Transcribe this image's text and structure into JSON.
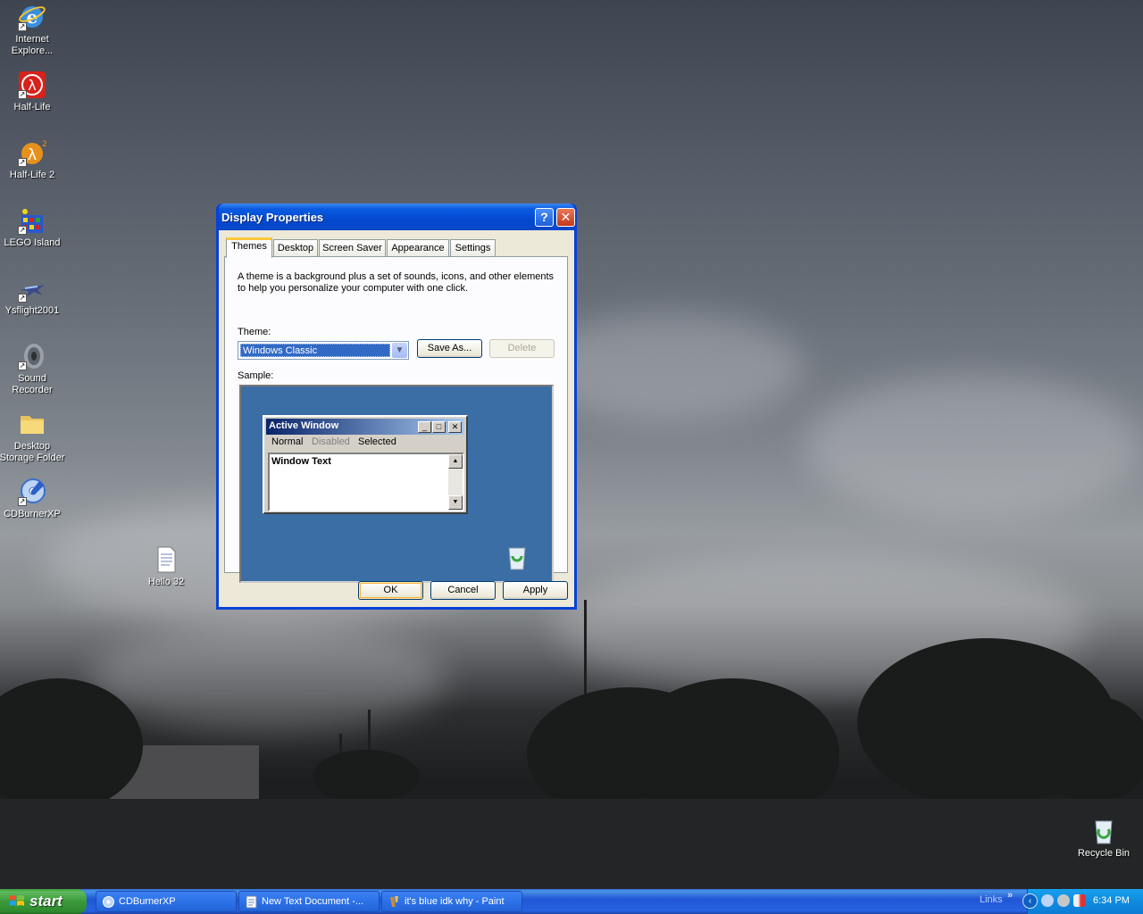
{
  "desktop": {
    "icons": [
      {
        "label": "Internet Explore...",
        "icon": "internet-explorer-icon"
      },
      {
        "label": "Half-Life",
        "icon": "half-life-icon"
      },
      {
        "label": "Half-Life 2",
        "icon": "half-life-2-icon"
      },
      {
        "label": "LEGO Island",
        "icon": "lego-island-icon"
      },
      {
        "label": "Ysflight2001",
        "icon": "ysflight-icon"
      },
      {
        "label": "Sound Recorder",
        "icon": "sound-recorder-icon"
      },
      {
        "label": "Desktop Storage Folder",
        "icon": "folder-icon"
      },
      {
        "label": "CDBurnerXP",
        "icon": "cdburnerxp-icon"
      },
      {
        "label": "Hello 32",
        "icon": "text-document-icon"
      },
      {
        "label": "Recycle Bin",
        "icon": "recycle-bin-icon"
      }
    ]
  },
  "dialog": {
    "title": "Display Properties",
    "help_glyph": "?",
    "close_glyph": "✕",
    "tabs": [
      "Themes",
      "Desktop",
      "Screen Saver",
      "Appearance",
      "Settings"
    ],
    "active_tab": "Themes",
    "description": "A theme is a background plus a set of sounds, icons, and other elements to help you personalize your computer with one click.",
    "theme_label": "Theme:",
    "theme_value": "Windows Classic",
    "save_as_label": "Save As...",
    "delete_label": "Delete",
    "sample_label": "Sample:",
    "sample": {
      "window_title": "Active Window",
      "menu": [
        "Normal",
        "Disabled",
        "Selected"
      ],
      "window_text": "Window Text"
    },
    "ok_label": "OK",
    "cancel_label": "Cancel",
    "apply_label": "Apply"
  },
  "taskbar": {
    "start_label": "start",
    "tasks": [
      {
        "label": "CDBurnerXP",
        "icon": "cdburnerxp-icon"
      },
      {
        "label": "New Text Document -...",
        "icon": "notepad-icon"
      },
      {
        "label": "it's blue idk why - Paint",
        "icon": "paint-icon"
      }
    ],
    "links_label": "Links",
    "links_chevron": "»",
    "clock": "6:34 PM"
  },
  "colors": {
    "xp_blue": "#0841d6",
    "dialog_face": "#ece9d8",
    "sample_desktop": "#3a6ea5",
    "start_green": "#3a9a3a",
    "tray_blue": "#0f8be0"
  }
}
